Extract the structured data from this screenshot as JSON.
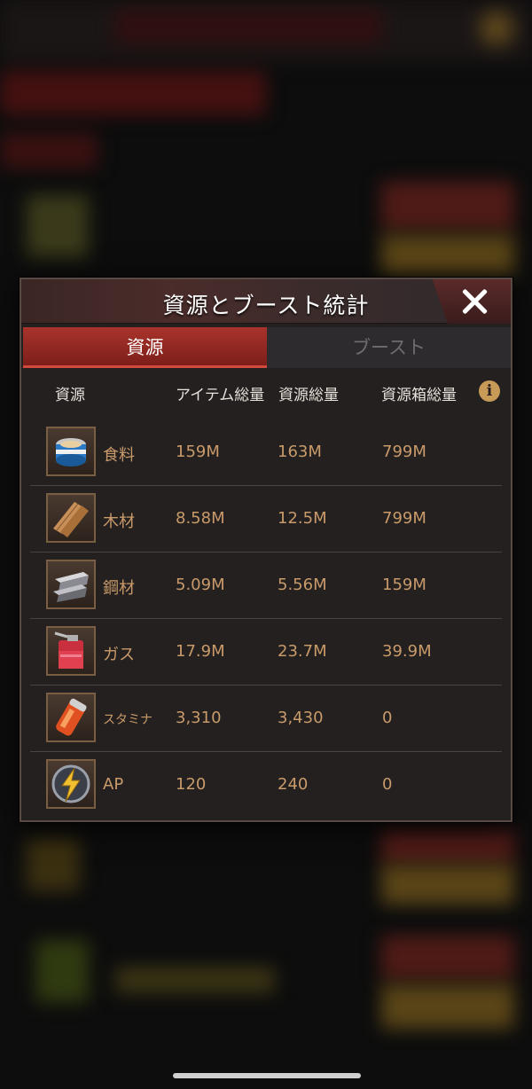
{
  "dialog": {
    "title": "資源とブースト統計",
    "tabs": [
      {
        "label": "資源",
        "active": true
      },
      {
        "label": "ブースト",
        "active": false
      }
    ],
    "columns": [
      "資源",
      "アイテム総量",
      "資源総量",
      "資源箱総量"
    ],
    "info_icon": "i",
    "rows": [
      {
        "icon": "canned-food-icon",
        "name": "食料",
        "item_total": "159M",
        "resource_total": "163M",
        "box_total": "799M"
      },
      {
        "icon": "wood-planks-icon",
        "name": "木材",
        "item_total": "8.58M",
        "resource_total": "12.5M",
        "box_total": "799M"
      },
      {
        "icon": "steel-ingot-icon",
        "name": "鋼材",
        "item_total": "5.09M",
        "resource_total": "5.56M",
        "box_total": "159M"
      },
      {
        "icon": "gas-can-icon",
        "name": "ガス",
        "item_total": "17.9M",
        "resource_total": "23.7M",
        "box_total": "39.9M"
      },
      {
        "icon": "stamina-can-icon",
        "name": "スタミナ",
        "item_total": "3,310",
        "resource_total": "3,430",
        "box_total": "0"
      },
      {
        "icon": "lightning-badge-icon",
        "name": "AP",
        "item_total": "120",
        "resource_total": "240",
        "box_total": "0"
      }
    ]
  },
  "colors": {
    "tab_active": "#a9342c",
    "value_text": "#c99a6a",
    "panel_bg": "#23201f"
  }
}
